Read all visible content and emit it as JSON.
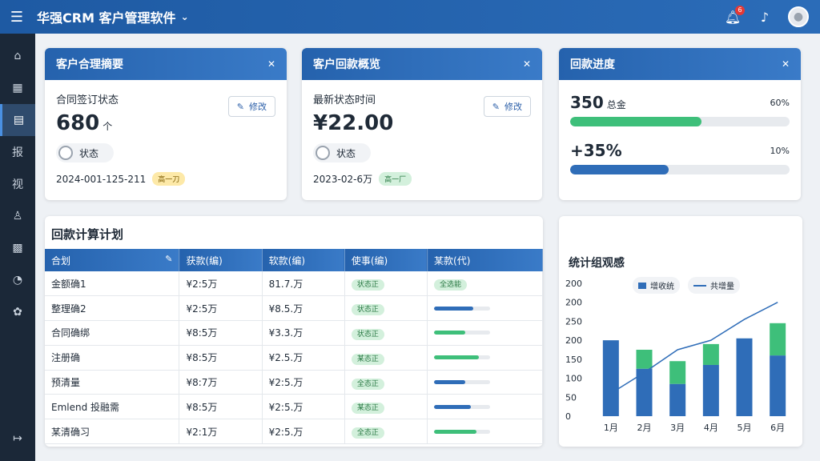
{
  "header": {
    "title": "华强CRM 客户管理软件",
    "notification_count": "6"
  },
  "colors": {
    "primary": "#2562ad",
    "sidebar": "#1b2838",
    "green": "#3ebf7a",
    "blue": "#2f6db8"
  },
  "sidebar": {
    "items": [
      {
        "icon": "home-icon",
        "glyph": "⌂"
      },
      {
        "icon": "dashboard-icon",
        "glyph": "▦"
      },
      {
        "icon": "document-icon",
        "glyph": "▤"
      },
      {
        "icon": "report-icon",
        "glyph": "报"
      },
      {
        "icon": "customer-icon",
        "glyph": "视"
      },
      {
        "icon": "people-icon",
        "glyph": "♙"
      },
      {
        "icon": "file-icon",
        "glyph": "▩"
      },
      {
        "icon": "pie-chart-icon",
        "glyph": "◔"
      },
      {
        "icon": "settings-icon",
        "glyph": "✿"
      },
      {
        "icon": "logout-icon",
        "glyph": "↦"
      }
    ]
  },
  "card1": {
    "title": "客户合理摘要",
    "label": "合同签订状态",
    "value": "680",
    "sub": "个",
    "edit": "修改",
    "toggle": "状态",
    "date": "2024-001-125-211",
    "tag": "高一刀"
  },
  "card2": {
    "title": "客户回款概览",
    "label": "最新状态时间",
    "value": "¥22.00",
    "edit": "修改",
    "toggle": "状态",
    "date": "2023-02-6万",
    "tag": "高一厂"
  },
  "card3": {
    "title": "回款进度",
    "row1": {
      "value": "350",
      "sub": "总金",
      "pct": "60%",
      "fill": 0.6
    },
    "row2": {
      "value": "+35%",
      "pct": "10%",
      "fill": 0.45
    }
  },
  "table": {
    "title": "回款计算计划",
    "headers": [
      "合划",
      "获款(编)",
      "软款(编)",
      "使事(编)",
      "某款(代)"
    ],
    "rows": [
      {
        "c1": "金额确1",
        "c2": "¥2:5万",
        "c3": "81.7.万",
        "c4": "状态正",
        "c5": {
          "type": "pill",
          "text": "全选能"
        }
      },
      {
        "c1": "整理确2",
        "c2": "¥2:5万",
        "c3": "¥8.5.万",
        "c4": "状态正",
        "c5": {
          "type": "bar",
          "fill": 0.7,
          "color": "#2f6db8"
        }
      },
      {
        "c1": "合同确绑",
        "c2": "¥8:5万",
        "c3": "¥3.3.万",
        "c4": "状态正",
        "c5": {
          "type": "bar",
          "fill": 0.55,
          "color": "#3ebf7a"
        }
      },
      {
        "c1": "注册确",
        "c2": "¥8:5万",
        "c3": "¥2.5.万",
        "c4": "某态正",
        "c5": {
          "type": "bar",
          "fill": 0.8,
          "color": "#3ebf7a"
        }
      },
      {
        "c1": "预清量",
        "c2": "¥8:7万",
        "c3": "¥2:5.万",
        "c4": "全态正",
        "c5": {
          "type": "bar",
          "fill": 0.55,
          "color": "#2f6db8"
        }
      },
      {
        "c1": "Emlend 投融需",
        "c2": "¥8:5万",
        "c3": "¥2:5.万",
        "c4": "某态正",
        "c5": {
          "type": "bar",
          "fill": 0.65,
          "color": "#2f6db8"
        }
      },
      {
        "c1": "某清确习",
        "c2": "¥2:1万",
        "c3": "¥2:5.万",
        "c4": "全态正",
        "c5": {
          "type": "bar",
          "fill": 0.75,
          "color": "#3ebf7a"
        }
      }
    ]
  },
  "chart_data": {
    "type": "bar",
    "title": "统计组观感",
    "categories": [
      "1月",
      "2月",
      "3月",
      "4月",
      "5月",
      "6月"
    ],
    "y_tick_labels": [
      "0",
      "50",
      "100",
      "150",
      "200",
      "250",
      "200",
      "200"
    ],
    "ylim": [
      0,
      350
    ],
    "series": [
      {
        "name": "增收统",
        "color": "#2f6db8",
        "values": [
          200,
          125,
          85,
          135,
          205,
          160
        ]
      },
      {
        "name": "",
        "color": "#3ebf7a",
        "values": [
          0,
          50,
          60,
          55,
          0,
          85
        ]
      }
    ],
    "line": {
      "name": "共增量",
      "color": "#2f6db8",
      "values": [
        60,
        115,
        175,
        200,
        255,
        300
      ]
    },
    "legend": "top",
    "grid": false
  }
}
